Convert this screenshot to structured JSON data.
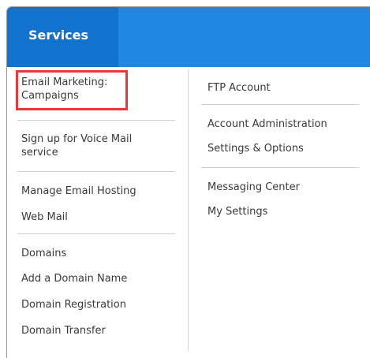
{
  "header": {
    "title": "Services"
  },
  "left_column": {
    "groups": [
      [
        "Email Marketing:\nCampaigns"
      ],
      [
        "Sign up for Voice Mail\nservice"
      ],
      [
        "Manage Email Hosting",
        "Web Mail"
      ],
      [
        "Domains",
        "Add a Domain Name",
        "Domain Registration",
        "Domain Transfer"
      ]
    ]
  },
  "right_column": {
    "groups": [
      [
        "FTP Account"
      ],
      [
        "Account Administration",
        "Settings & Options"
      ],
      [
        "Messaging Center",
        "My Settings"
      ]
    ]
  },
  "colors": {
    "header_bar": "#1f86e1",
    "header_tab": "#1273cf",
    "highlight_border": "#e53a3a"
  }
}
